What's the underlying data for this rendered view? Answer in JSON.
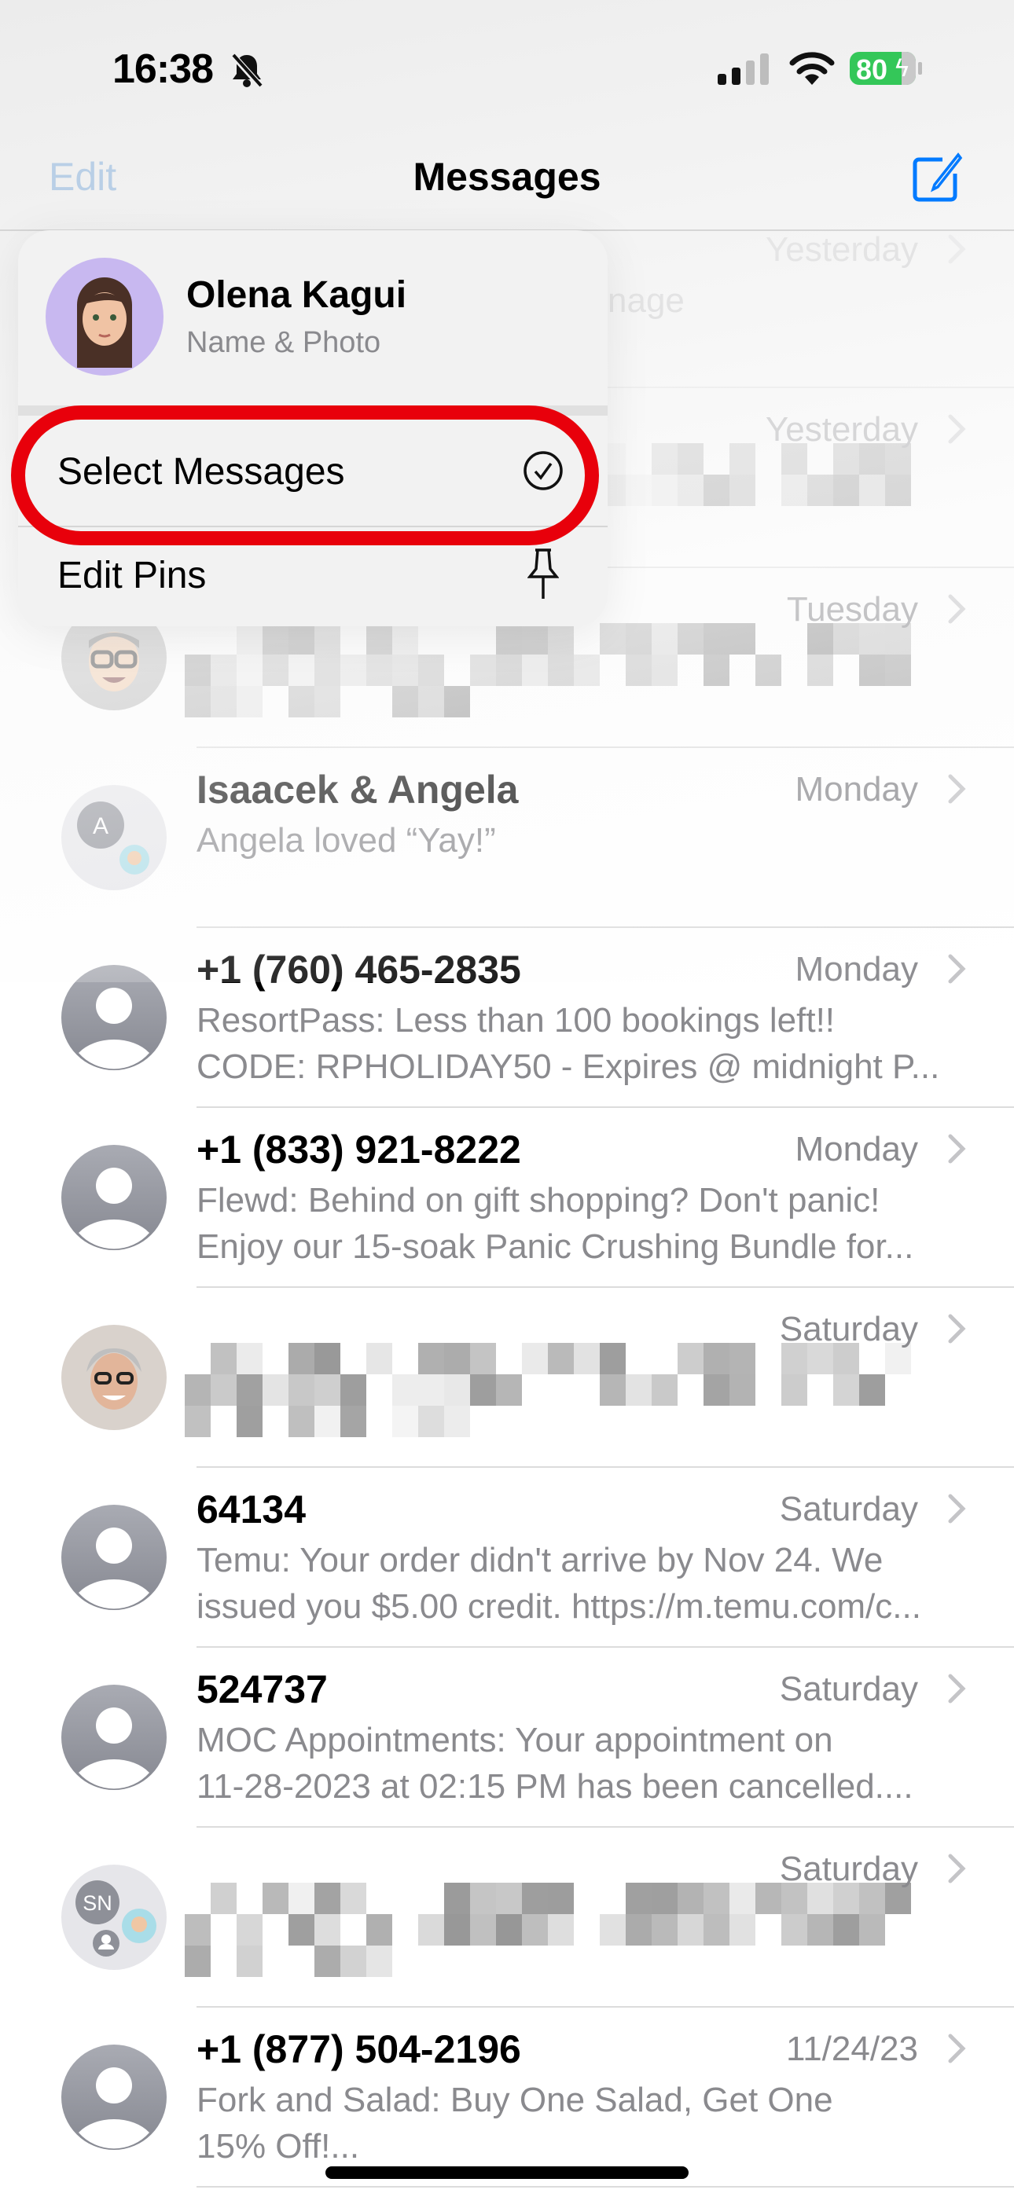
{
  "status_bar": {
    "time": "16:38",
    "battery": "80",
    "battery_color": "#34c759",
    "icons": [
      "bell-slash-icon",
      "cellular-signal-icon",
      "wifi-icon",
      "battery-charging-icon"
    ]
  },
  "nav": {
    "edit_label": "Edit",
    "title": "Messages",
    "compose_icon": "compose-icon",
    "accent": "#007aff"
  },
  "menu": {
    "profile_name": "Olena Kagui",
    "profile_sub": "Name & Photo",
    "items": [
      {
        "label": "Select Messages",
        "icon": "checkmark-circle-icon",
        "highlighted": true
      },
      {
        "label": "Edit Pins",
        "icon": "pin-icon"
      }
    ]
  },
  "conversations": [
    {
      "name": "",
      "preview": "nage",
      "date": "Yesterday",
      "avatar": "hidden",
      "blurred": false
    },
    {
      "name": "",
      "preview": "",
      "date": "Yesterday",
      "avatar": "hidden",
      "blurred": true
    },
    {
      "name": "",
      "preview": "",
      "date": "Tuesday",
      "avatar": "memoji",
      "blurred": true
    },
    {
      "name": "Isaacek & Angela",
      "preview": "Angela loved “Yay!”",
      "date": "Monday",
      "avatar": "group-a",
      "avatar_initial": "A"
    },
    {
      "name": "+1 (760) 465-2835",
      "preview": "ResortPass: Less than 100 bookings left!!\nCODE: RPHOLIDAY50 - Expires @ midnight P...",
      "date": "Monday",
      "avatar": "person"
    },
    {
      "name": "+1 (833) 921-8222",
      "preview": "Flewd: Behind on gift shopping? Don't panic!\nEnjoy our 15-soak Panic Crushing Bundle for...",
      "date": "Monday",
      "avatar": "person"
    },
    {
      "name": "",
      "preview": "",
      "date": "Saturday",
      "avatar": "photo",
      "blurred": true
    },
    {
      "name": "64134",
      "preview": "Temu: Your order didn't arrive by Nov 24. We\nissued you $5.00 credit. https://m.temu.com/c...",
      "date": "Saturday",
      "avatar": "person"
    },
    {
      "name": "524737",
      "preview": "MOC Appointments: Your appointment on\n11-28-2023 at 02:15 PM has been cancelled....",
      "date": "Saturday",
      "avatar": "person"
    },
    {
      "name": "",
      "preview": "",
      "date": "Saturday",
      "avatar": "group-sn",
      "avatar_initial": "SN",
      "blurred": true
    },
    {
      "name": "+1 (877) 504-2196",
      "preview": "Fork and Salad: Buy One Salad, Get One\n15% Off!...",
      "date": "11/24/23",
      "avatar": "person"
    }
  ]
}
